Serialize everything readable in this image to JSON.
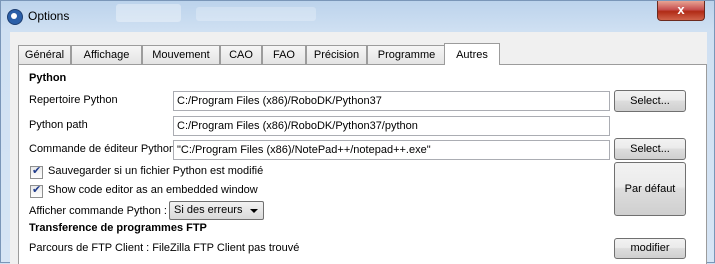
{
  "window": {
    "title": "Options",
    "close_label": "x"
  },
  "tabs": [
    {
      "label": "Général"
    },
    {
      "label": "Affichage"
    },
    {
      "label": "Mouvement"
    },
    {
      "label": "CAO"
    },
    {
      "label": "FAO"
    },
    {
      "label": "Précision"
    },
    {
      "label": "Programme"
    },
    {
      "label": "Autres",
      "active": true
    }
  ],
  "python": {
    "section_title": "Python",
    "rep_label": "Repertoire Python",
    "rep_value": "C:/Program Files (x86)/RoboDK/Python37",
    "rep_button": "Select...",
    "path_label": "Python path",
    "path_value": "C:/Program Files (x86)/RoboDK/Python37/python",
    "editor_label": "Commande de éditeur Python",
    "editor_value": "\"C:/Program Files (x86)/NotePad++/notepad++.exe\"",
    "editor_button": "Select...",
    "save_check_label": "Sauvegarder si un fichier Python est modifié",
    "save_checked": true,
    "embedded_check_label": "Show code editor as an embedded window",
    "embedded_checked": true,
    "show_cmd_label": "Afficher commande Python :",
    "show_cmd_value": "Si des erreurs",
    "default_button": "Par défaut"
  },
  "ftp": {
    "section_title": "Transference de programmes FTP",
    "client_label": "Parcours de FTP Client : FileZilla FTP Client pas trouvé",
    "modify_button": "modifier"
  }
}
